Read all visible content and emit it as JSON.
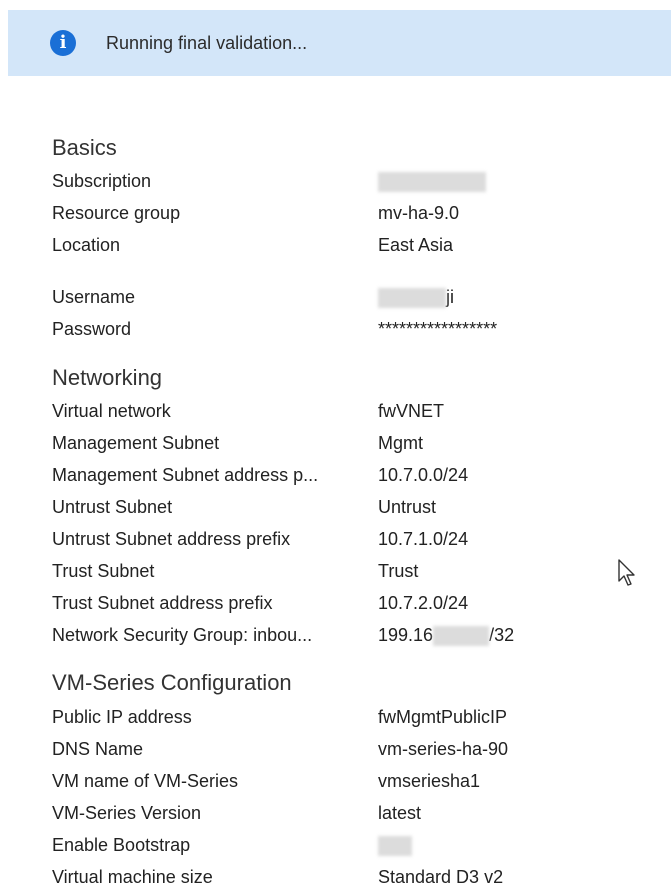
{
  "banner": {
    "icon": "info-icon",
    "message": "Running final validation..."
  },
  "basics": {
    "title": "Basics",
    "rows": [
      {
        "label": "Subscription",
        "value": ""
      },
      {
        "label": "Resource group",
        "value": "mv-ha-9.0"
      },
      {
        "label": "Location",
        "value": "East Asia"
      },
      {
        "label": "Username",
        "value": "ji"
      },
      {
        "label": "Password",
        "value": "*****************"
      }
    ]
  },
  "networking": {
    "title": "Networking",
    "rows": [
      {
        "label": "Virtual network",
        "value": "fwVNET"
      },
      {
        "label": "Management Subnet",
        "value": "Mgmt"
      },
      {
        "label": "Management Subnet address p...",
        "value": "10.7.0.0/24"
      },
      {
        "label": "Untrust Subnet",
        "value": "Untrust"
      },
      {
        "label": "Untrust Subnet address prefix",
        "value": "10.7.1.0/24"
      },
      {
        "label": "Trust Subnet",
        "value": "Trust"
      },
      {
        "label": "Trust Subnet address prefix",
        "value": "10.7.2.0/24"
      },
      {
        "label": "Network Security Group: inbou...",
        "value_prefix": "199.16",
        "value_suffix": "/32"
      }
    ]
  },
  "vmseries": {
    "title": "VM-Series Configuration",
    "rows": [
      {
        "label": "Public IP address",
        "value": "fwMgmtPublicIP"
      },
      {
        "label": "DNS Name",
        "value": "vm-series-ha-90"
      },
      {
        "label": "VM name of VM-Series",
        "value": "vmseriesha1"
      },
      {
        "label": "VM-Series Version",
        "value": "latest"
      },
      {
        "label": "Enable Bootstrap",
        "value": ""
      },
      {
        "label": "Virtual machine size",
        "value": "Standard D3 v2"
      }
    ]
  },
  "cursor": {
    "icon": "mouse-pointer-icon"
  }
}
